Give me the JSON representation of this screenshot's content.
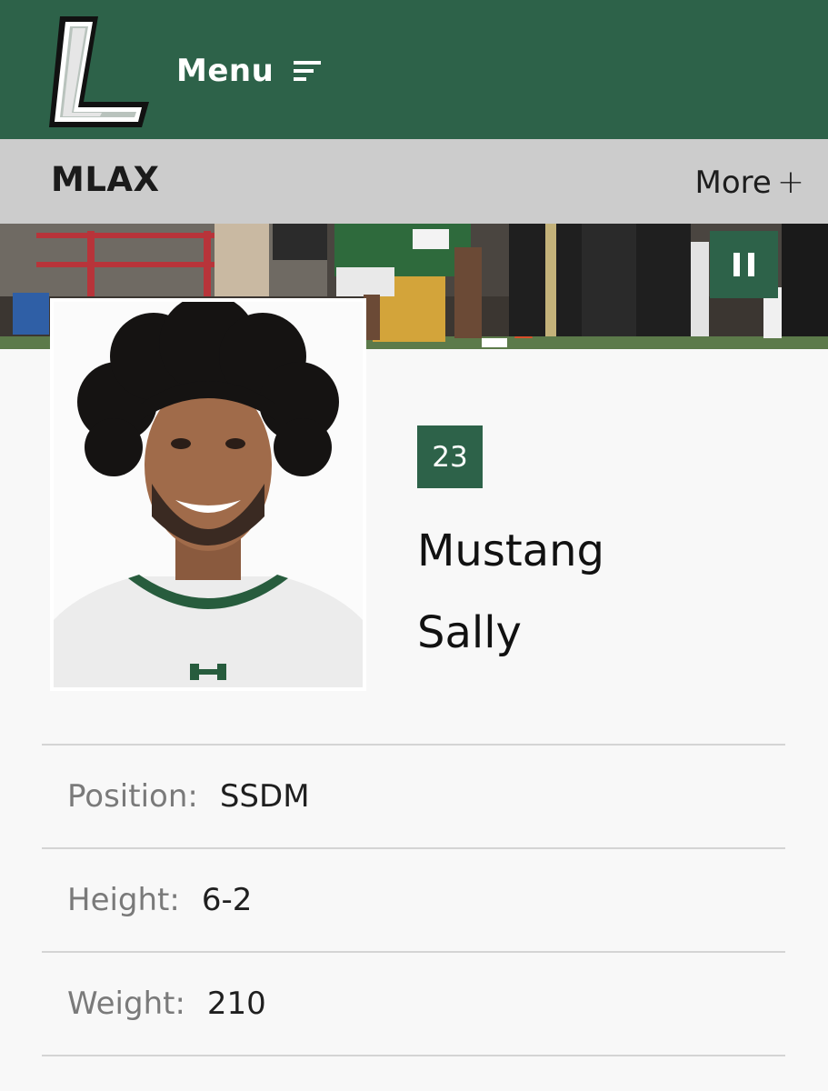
{
  "header": {
    "logo_icon": "letter-l-logo-icon",
    "menu_label": "Menu",
    "menu_icon": "hamburger-menu-icon"
  },
  "subnav": {
    "title": "MLAX",
    "more_label": "More",
    "more_icon": "+"
  },
  "banner": {
    "pause_icon": "pause-icon"
  },
  "player": {
    "number": "23",
    "first_name": "Mustang",
    "last_name": "Sally",
    "details": [
      {
        "label": "Position:",
        "value": "SSDM"
      },
      {
        "label": "Height:",
        "value": "6-2"
      },
      {
        "label": "Weight:",
        "value": "210"
      }
    ]
  },
  "colors": {
    "brand_green": "#2d6249",
    "subnav_gray": "#cccccc",
    "page_bg": "#f8f8f8"
  }
}
